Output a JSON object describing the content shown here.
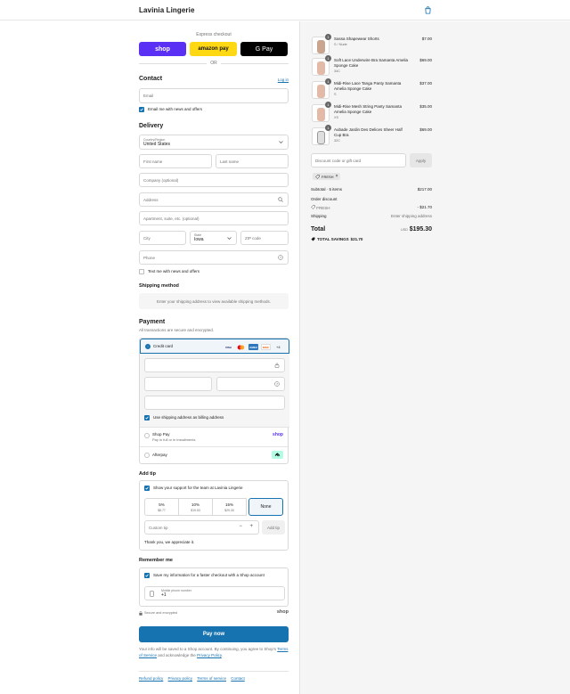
{
  "header": {
    "brand": "Lavinia Lingerie"
  },
  "express": {
    "label": "Express checkout",
    "buttons": [
      "shop",
      "amazon pay",
      "G Pay"
    ],
    "or": "OR"
  },
  "contact": {
    "title": "Contact",
    "login": "Log in",
    "email_placeholder": "Email",
    "email_news": "Email me with news and offers"
  },
  "delivery": {
    "title": "Delivery",
    "country_label": "Country/Region",
    "country_value": "United States",
    "first_name": "First name",
    "last_name": "Last name",
    "company": "Company (optional)",
    "address": "Address",
    "apartment": "Apartment, suite, etc. (optional)",
    "city": "City",
    "state_label": "State",
    "state_value": "Iowa",
    "zip": "ZIP code",
    "phone": "Phone",
    "text_news": "Text me with news and offers"
  },
  "shipping": {
    "title": "Shipping method",
    "placeholder": "Enter your shipping address to view available shipping methods."
  },
  "payment": {
    "title": "Payment",
    "subtitle": "All transactions are secure and encrypted.",
    "credit_card": "Credit card",
    "card_logos": [
      "VISA",
      "MC",
      "AMEX",
      "DISC"
    ],
    "more_cards": "+4",
    "billing_same": "Use shipping address as billing address",
    "shop_pay": "Shop Pay",
    "shop_pay_sub": "Pay in full or in installments",
    "shop_pay_logo": "shop",
    "afterpay": "Afterpay"
  },
  "tip": {
    "title": "Add tip",
    "support": "Show your support for the team at Lavinia Lingerie",
    "options": [
      {
        "pct": "5%",
        "amt": "$8.77"
      },
      {
        "pct": "10%",
        "amt": "$19.53"
      },
      {
        "pct": "15%",
        "amt": "$29.30"
      }
    ],
    "none": "None",
    "custom_placeholder": "Custom tip",
    "add_button": "Add tip",
    "thanks": "Thank you, we appreciate it."
  },
  "remember": {
    "title": "Remember me",
    "save_info": "Save my information for a faster checkout with a Shop account",
    "phone_label": "Mobile phone number",
    "phone_value": "+1",
    "secure": "Secure and encrypted",
    "shop_logo": "shop"
  },
  "pay_now": "Pay now",
  "footnote": {
    "text1": "Your info will be saved to a Shop account. By continuing, you agree to Shop's",
    "tos": "Terms of Service",
    "text2": "and acknowledge the",
    "privacy": "Privacy Policy",
    "end": "."
  },
  "footer_links": [
    "Refund policy",
    "Privacy policy",
    "Terms of service",
    "Contact"
  ],
  "cart": {
    "items": [
      {
        "qty": "1",
        "name": "Sassa Shapewear Shorts",
        "variant": "S / Nude",
        "price": "$7.00"
      },
      {
        "qty": "1",
        "name": "Soft Lace Underwire Bra Samanta Amelia Sponge Cake",
        "variant": "34C",
        "price": "$69.00"
      },
      {
        "qty": "1",
        "name": "Midi-Rise Lace Tanga Panty Samanta Amelia Sponge Cake",
        "variant": "S",
        "price": "$37.00"
      },
      {
        "qty": "1",
        "name": "Midi-Rise Mesh String Panty Samanta Amelia Sponge Cake",
        "variant": "XS",
        "price": "$35.00"
      },
      {
        "qty": "1",
        "name": "Aubade Jardin Des Delices Sheer Half Cup Bra",
        "variant": "32C",
        "price": "$69.00"
      }
    ],
    "discount_placeholder": "Discount code or gift card",
    "apply": "Apply",
    "applied_code": "FRESH",
    "subtotal_label": "Subtotal · 5 items",
    "subtotal": "$217.00",
    "order_discount": "Order discount",
    "discount_code": "FRESH",
    "discount_amount": "- $21.70",
    "shipping_label": "Shipping",
    "shipping_value": "Enter shipping address",
    "total_label": "Total",
    "currency": "USD",
    "total": "$195.30",
    "savings_label": "TOTAL SAVINGS",
    "savings": "$21.70"
  },
  "colors": {
    "accent": "#1773b0",
    "shop": "#5a31f4",
    "amazon": "#ffd814",
    "afterpay": "#b2fce4"
  }
}
